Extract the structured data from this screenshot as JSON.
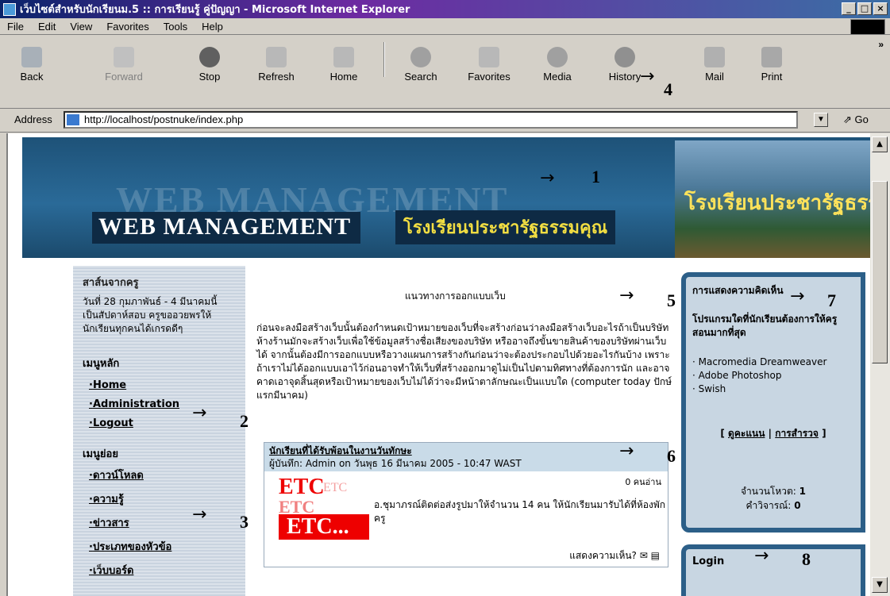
{
  "window": {
    "title": "เว็บไซต์สำหรับนักเรียนม.5 :: การเรียนรู้ คู่ปัญญา - Microsoft Internet Explorer",
    "min": "_",
    "max": "□",
    "close": "×"
  },
  "menu": [
    "File",
    "Edit",
    "View",
    "Favorites",
    "Tools",
    "Help"
  ],
  "toolbar": [
    {
      "label": "Back",
      "icon": "back-icon"
    },
    {
      "label": "Forward",
      "icon": "forward-icon"
    },
    {
      "label": "Stop",
      "icon": "stop-icon"
    },
    {
      "label": "Refresh",
      "icon": "refresh-icon"
    },
    {
      "label": "Home",
      "icon": "home-icon"
    },
    {
      "label": "Search",
      "icon": "search-icon"
    },
    {
      "label": "Favorites",
      "icon": "favorites-icon"
    },
    {
      "label": "Media",
      "icon": "media-icon"
    },
    {
      "label": "History",
      "icon": "history-icon"
    },
    {
      "label": "Mail",
      "icon": "mail-icon"
    },
    {
      "label": "Print",
      "icon": "print-icon"
    }
  ],
  "address": {
    "label": "Address",
    "url": "http://localhost/postnuke/index.php",
    "go": "Go"
  },
  "banner": {
    "ghost": "WEB MANAGEMENT",
    "title": "WEB MANAGEMENT",
    "thai": "โรงเรียนประชารัฐธรรมคุณ",
    "photo_text": "โรงเรียนประชารัฐธรรมคุณ"
  },
  "left": {
    "msg_title": "สาส์นจากครู",
    "msg_body": "วันที่ 28 กุมภาพันธ์ - 4 มีนาคมนี้ เป็นสัปดาห์สอบ ครูขออวยพรให้นักเรียนทุกคนได้เกรดดีๆ",
    "main_title": "เมนูหลัก",
    "main": [
      "Home",
      "Administration",
      "Logout"
    ],
    "sub_title": "เมนูย่อย",
    "sub": [
      "ดาวน์โหลด",
      "ความรู้",
      "ข่าวสาร",
      "ประเภทของหัวข้อ",
      "เว็บบอร์ด"
    ]
  },
  "center": {
    "title": "แนวทางการออกแบบเว็บ",
    "body": "ก่อนจะลงมือสร้างเว็บนั้นต้องกำหนดเป้าหมายของเว็บที่จะสร้างก่อนว่าลงมือสร้างเว็บอะไรถ้าเป็นบริษัท ห้างร้านมักจะสร้างเว็บเพื่อใช้ข้อมูลสร้างชื่อเสียงของบริษัท หรืออาจถึงขั้นขายสินค้าของบริษัทผ่านเว็บได้ จากนั้นต้องมีการออกแบบหรือวางแผนการสร้างกันก่อนว่าจะต้องประกอบไปด้วยอะไรกันบ้าง เพราะถ้าเราไม่ได้ออกแบบเอาไว้ก่อนอาจทำให้เว็บที่สร้างออกมาดูไม่เป็นไปตามทิศทางที่ต้องการนัก และอาจคาดเอาจุดสิ้นสุดหรือเป้าหมายของเว็บไม่ได้ว่าจะมีหน้าตาลักษณะเป็นแบบใด (computer today ปักษ์แรกมีนาคม)"
  },
  "news": {
    "title": "นักเรียนที่ได้รับพ้อนในงานวันทักษะ",
    "meta": "ผู้บันทึก: Admin on วันพุธ 16 มีนาคม 2005 - 10:47 WAST",
    "reads": "0 คนอ่าน",
    "logo_a": "ETC",
    "logo_a2": "ETC",
    "logo_b": "ETC",
    "logo_c": "ETC...",
    "text": "อ.ชุมาภรณ์ติดต่อส่งรูปมาให้จำนวน 14 คน ให้นักเรียนมารับได้ที่ห้องพักครู",
    "footer": "แสดงความเห็น?"
  },
  "right": {
    "title": "การแสดงความคิดเห็น",
    "question": "โปรแกรมใดที่นักเรียนต้องการให้ครูสอนมากที่สุด",
    "options": [
      "· Macromedia Dreamweaver",
      "· Adobe Photoshop",
      "· Swish"
    ],
    "link1": "ดูคะแนน",
    "link2": "การสำรวจ",
    "votes_label": "จำนวนโหวต:",
    "votes": "1",
    "comments_label": "คำวิจารณ์:",
    "comments": "0",
    "login": "Login"
  },
  "annotations": [
    "1",
    "2",
    "3",
    "4",
    "5",
    "6",
    "7",
    "8"
  ]
}
